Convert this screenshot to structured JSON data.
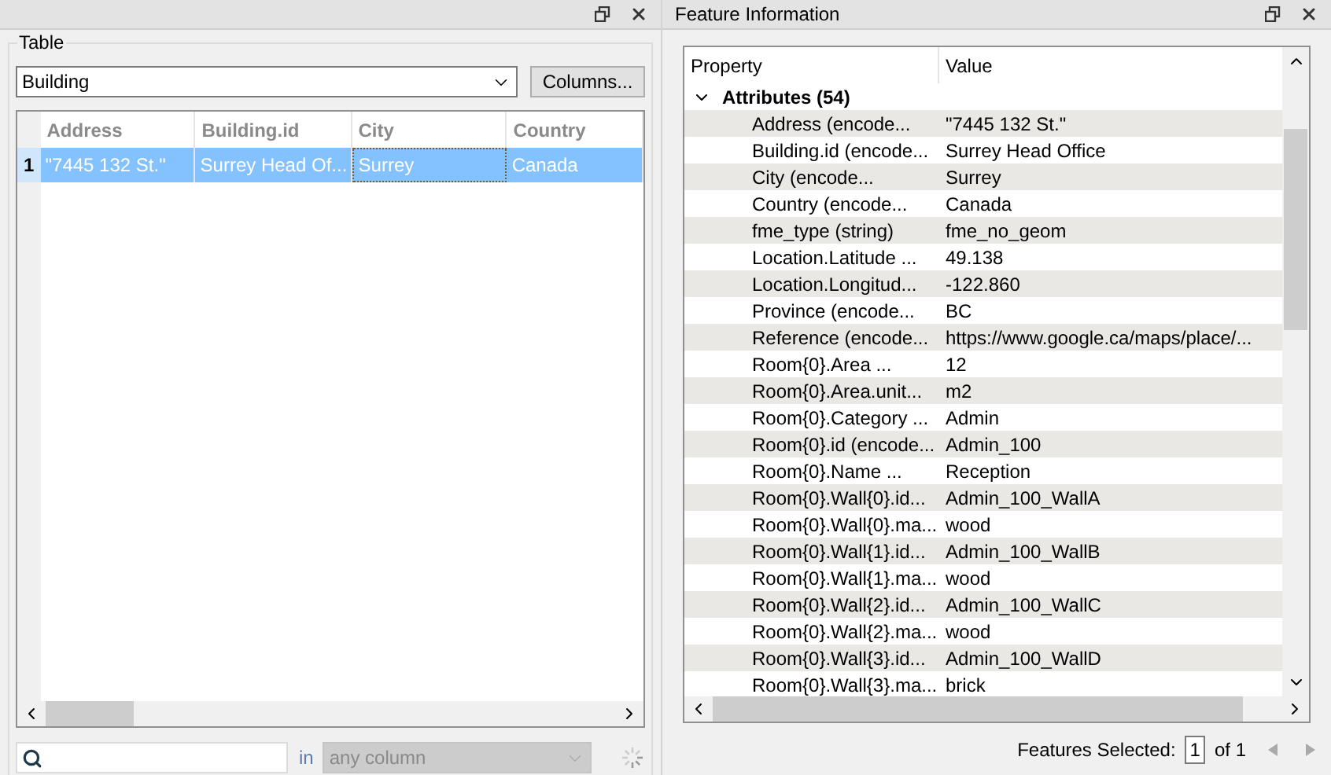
{
  "table_panel": {
    "group_label": "Table",
    "table_select": {
      "value": "Building"
    },
    "columns_button": "Columns...",
    "table": {
      "columns": [
        "Address",
        "Building.id",
        "City",
        "Country"
      ],
      "rows": [
        {
          "number": "1",
          "selected": true,
          "cells": [
            {
              "text": "\"7445 132 St.\"",
              "focused": false
            },
            {
              "text": "Surrey Head Of...",
              "focused": false
            },
            {
              "text": "Surrey",
              "focused": true
            },
            {
              "text": "Canada",
              "focused": false
            }
          ]
        }
      ]
    },
    "search": {
      "in_label": "in",
      "column_select": {
        "value": "any column",
        "disabled": true
      }
    }
  },
  "feature_panel": {
    "title": "Feature Information",
    "columns": [
      "Property",
      "Value"
    ],
    "groups": [
      {
        "label": "Attributes (54)",
        "expanded": true,
        "children": [
          {
            "property": "Address (encode...",
            "value": "\"7445 132 St.\""
          },
          {
            "property": "Building.id (encode...",
            "value": "Surrey Head Office"
          },
          {
            "property": "City (encode...",
            "value": "Surrey"
          },
          {
            "property": "Country (encode...",
            "value": "Canada"
          },
          {
            "property": "fme_type (string)",
            "value": "fme_no_geom"
          },
          {
            "property": "Location.Latitude ...",
            "value": "49.138"
          },
          {
            "property": "Location.Longitud...",
            "value": "-122.860"
          },
          {
            "property": "Province (encode...",
            "value": "BC"
          },
          {
            "property": "Reference (encode...",
            "value": "https://www.google.ca/maps/place/..."
          },
          {
            "property": "Room{0}.Area ...",
            "value": "12"
          },
          {
            "property": "Room{0}.Area.unit...",
            "value": "m2"
          },
          {
            "property": "Room{0}.Category ...",
            "value": "Admin"
          },
          {
            "property": "Room{0}.id (encode...",
            "value": "Admin_100"
          },
          {
            "property": "Room{0}.Name ...",
            "value": "Reception"
          },
          {
            "property": "Room{0}.Wall{0}.id...",
            "value": "Admin_100_WallA"
          },
          {
            "property": "Room{0}.Wall{0}.ma...",
            "value": "wood"
          },
          {
            "property": "Room{0}.Wall{1}.id...",
            "value": "Admin_100_WallB"
          },
          {
            "property": "Room{0}.Wall{1}.ma...",
            "value": "wood"
          },
          {
            "property": "Room{0}.Wall{2}.id...",
            "value": "Admin_100_WallC"
          },
          {
            "property": "Room{0}.Wall{2}.ma...",
            "value": "wood"
          },
          {
            "property": "Room{0}.Wall{3}.id...",
            "value": "Admin_100_WallD"
          },
          {
            "property": "Room{0}.Wall{3}.ma...",
            "value": "brick"
          }
        ]
      }
    ],
    "footer": {
      "label": "Features Selected:",
      "current": "1",
      "total": "of 1"
    }
  }
}
